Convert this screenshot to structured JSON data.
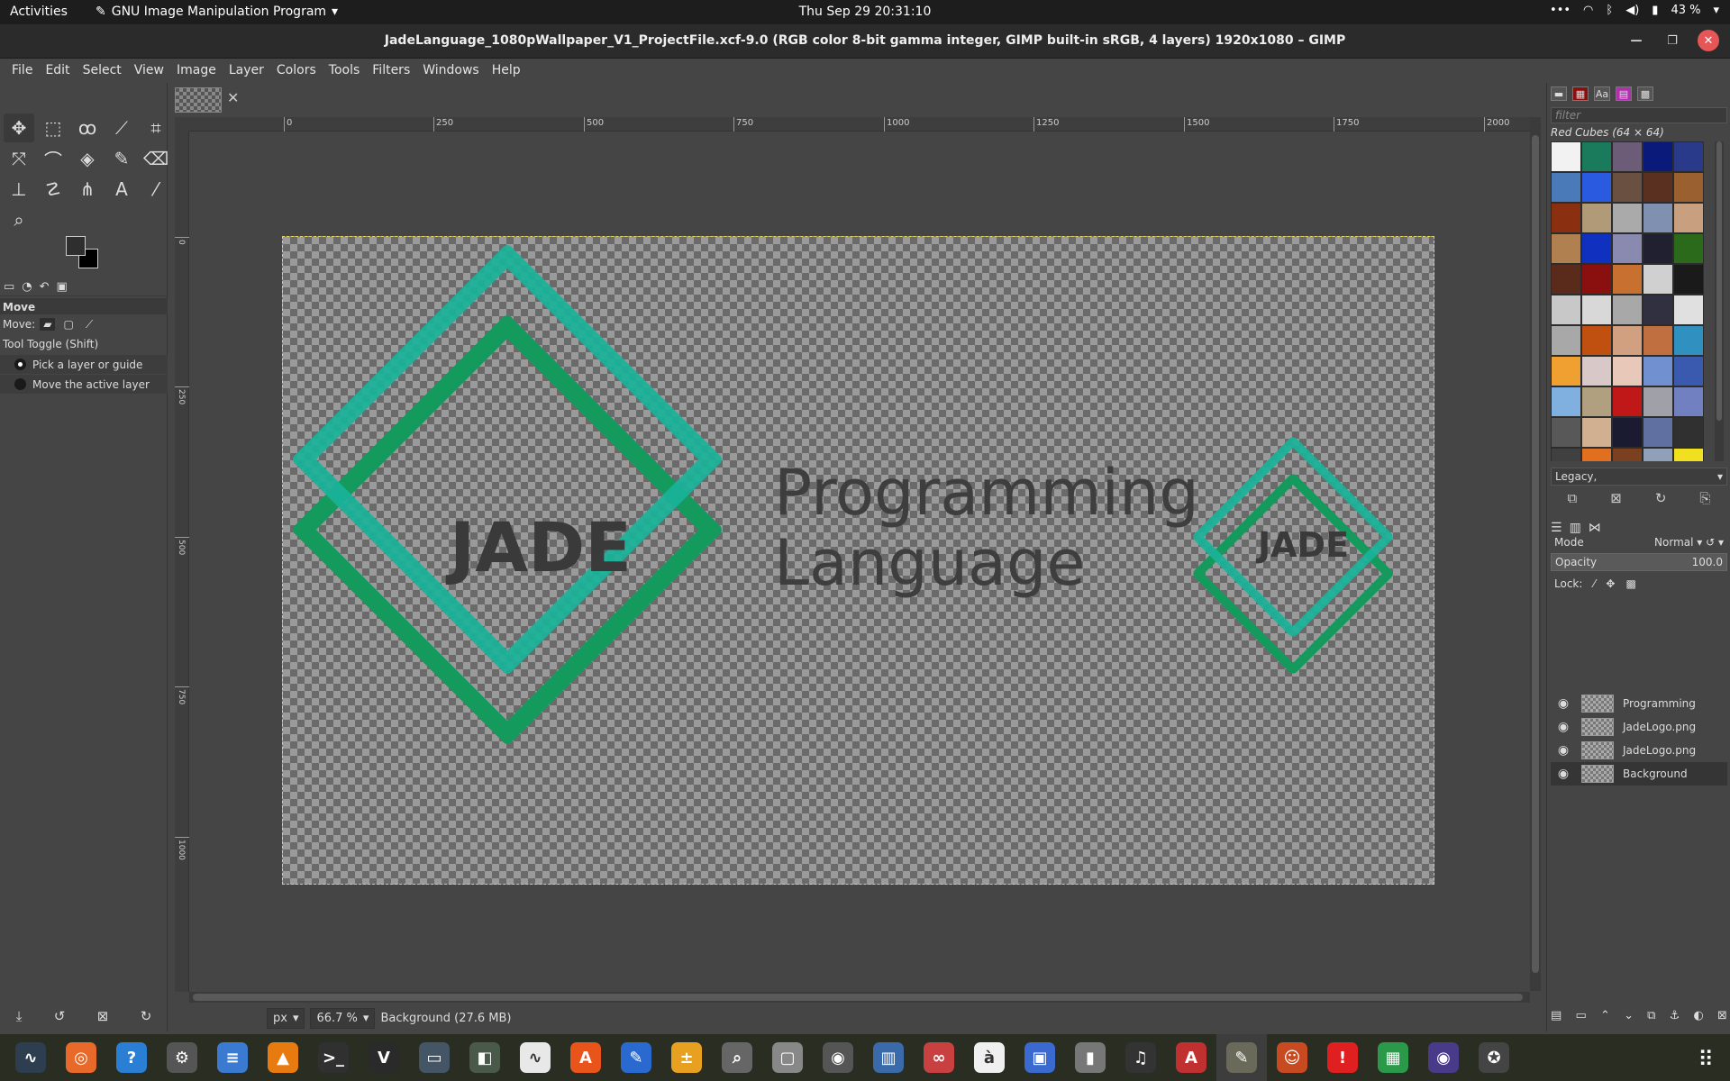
{
  "topbar": {
    "activities": "Activities",
    "app_name": "GNU Image Manipulation Program",
    "clock": "Thu Sep 29  20:31:10",
    "battery": "43 %"
  },
  "window": {
    "title": "JadeLanguage_1080pWallpaper_V1_ProjectFile.xcf-9.0 (RGB color 8-bit gamma integer, GIMP built-in sRGB, 4 layers) 1920x1080 – GIMP"
  },
  "menu": [
    "File",
    "Edit",
    "Select",
    "View",
    "Image",
    "Layer",
    "Colors",
    "Tools",
    "Filters",
    "Windows",
    "Help"
  ],
  "tool_options": {
    "title": "Move",
    "move_label": "Move:",
    "toggle_label": "Tool Toggle  (Shift)",
    "option_pick": "Pick a layer or guide",
    "option_move": "Move the active layer"
  },
  "ruler": {
    "h_ticks": [
      "0",
      "250",
      "500",
      "750",
      "1000",
      "1250",
      "1500",
      "1750",
      "2000"
    ],
    "v_ticks": [
      "0",
      "250",
      "500",
      "750",
      "1000"
    ]
  },
  "artwork": {
    "jade_big": "JADE",
    "jade_small": "JADE",
    "line1": "Programming",
    "line2": "Language",
    "teal": "#19b39a",
    "green": "#159a5e"
  },
  "status": {
    "unit": "px",
    "zoom": "66.7 %",
    "info": "Background (27.6 MB)"
  },
  "patterns": {
    "filter_placeholder": "filter",
    "name": "Red Cubes (64 × 64)",
    "tag_combo": "Legacy,",
    "swatches": [
      "#f2f2f2",
      "#1a7a5c",
      "#6d5c78",
      "#0a1a7a",
      "#2a3a8a",
      "#4a7ab8",
      "#2a5ae0",
      "#6a5040",
      "#5a3020",
      "#9a6030",
      "#8a3010",
      "#b09a78",
      "#aaaaaa",
      "#8090b0",
      "#c8a080",
      "#b08050",
      "#1030c0",
      "#8a8ab0",
      "#202030",
      "#2a6a1a",
      "#5a2a1a",
      "#8a1010",
      "#c87030",
      "#d0d0d0",
      "#1a1a1a",
      "#c8c8c8",
      "#d8d8d8",
      "#a8a8a8",
      "#303040",
      "#e0e0e0",
      "#a8a8a8",
      "#c05010",
      "#d0a080",
      "#c07040",
      "#3090c0",
      "#f0a030",
      "#d8c8c8",
      "#e8c8b8",
      "#7090d0",
      "#3a5ab0",
      "#80b0e0",
      "#b0a080",
      "#c01818",
      "#a0a0a8",
      "#7080c0",
      "#585858",
      "#d0b090",
      "#1a1a30",
      "#6070a0",
      "#303030",
      "#404040",
      "#e07020",
      "#7a4020",
      "#90a0b8",
      "#f0e020"
    ]
  },
  "layers": {
    "mode_label": "Mode",
    "mode_value": "Normal",
    "opacity_label": "Opacity",
    "opacity_value": "100.0",
    "lock_label": "Lock:",
    "items": [
      {
        "name": "Programming"
      },
      {
        "name": "JadeLogo.png"
      },
      {
        "name": "JadeLogo.png"
      },
      {
        "name": "Background"
      }
    ]
  },
  "dock_apps": [
    {
      "icon": "system-monitor-icon",
      "color": "#2c3e50"
    },
    {
      "icon": "firefox-icon",
      "color": "#e8692a"
    },
    {
      "icon": "help-icon",
      "color": "#2a7fd4"
    },
    {
      "icon": "settings-icon",
      "color": "#555555"
    },
    {
      "icon": "text-document-icon",
      "color": "#3a7ad0"
    },
    {
      "icon": "vlc-icon",
      "color": "#e87b10"
    },
    {
      "icon": "terminal-icon",
      "color": "#303030"
    },
    {
      "icon": "vim-icon",
      "color": "#2a2a2a"
    },
    {
      "icon": "remote-desktop-icon",
      "color": "#445566"
    },
    {
      "icon": "gimp-extension-icon",
      "color": "#4a5a4a"
    },
    {
      "icon": "waveform-icon",
      "color": "#e8e8e8"
    },
    {
      "icon": "app-center-icon",
      "color": "#e8541a"
    },
    {
      "icon": "text-editor-icon",
      "color": "#2a6ad0"
    },
    {
      "icon": "calculator-icon",
      "color": "#e8a020"
    },
    {
      "icon": "search-icon",
      "color": "#666666"
    },
    {
      "icon": "files-icon",
      "color": "#888888"
    },
    {
      "icon": "disk-icon",
      "color": "#555555"
    },
    {
      "icon": "book-icon",
      "color": "#3a6aaa"
    },
    {
      "icon": "glasses-icon",
      "color": "#c84040"
    },
    {
      "icon": "font-viewer-icon",
      "color": "#f0f0f0"
    },
    {
      "icon": "screenshot-icon",
      "color": "#3a6ad0"
    },
    {
      "icon": "archive-icon",
      "color": "#777777"
    },
    {
      "icon": "music-icon",
      "color": "#333333"
    },
    {
      "icon": "pdf-icon",
      "color": "#c03030"
    },
    {
      "icon": "gimp-icon",
      "color": "#6a6a5a"
    },
    {
      "icon": "game-icon",
      "color": "#c84a20"
    },
    {
      "icon": "alert-icon",
      "color": "#e02020"
    },
    {
      "icon": "spreadsheet-icon",
      "color": "#2a9a4a"
    },
    {
      "icon": "obs-icon",
      "color": "#4a3a8a"
    },
    {
      "icon": "inkscape-icon",
      "color": "#444444"
    }
  ]
}
